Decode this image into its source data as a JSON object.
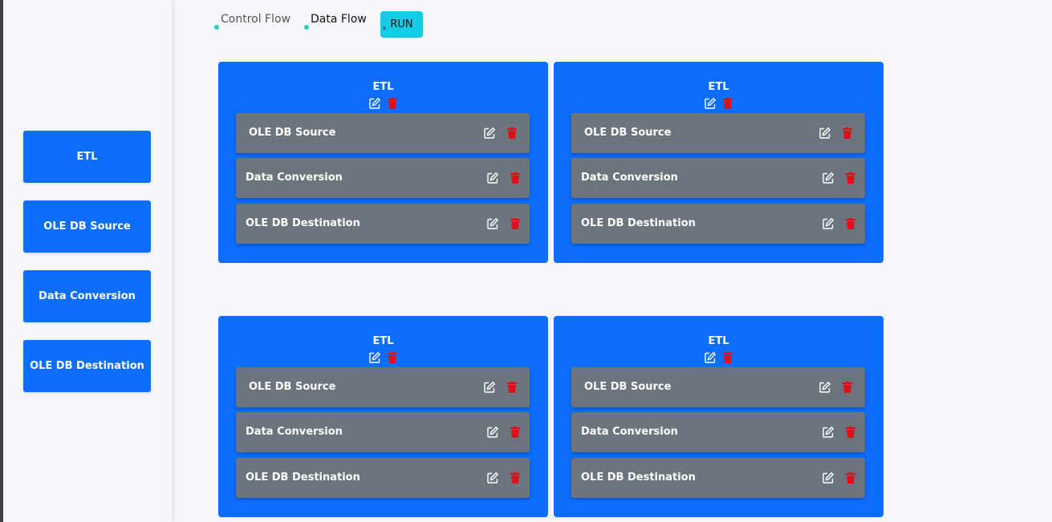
{
  "sidebar": {
    "items": [
      {
        "label": "ETL"
      },
      {
        "label": "OLE DB Source"
      },
      {
        "label": "Data Conversion"
      },
      {
        "label": "OLE DB Destination"
      }
    ]
  },
  "toolbar": {
    "tabs": [
      {
        "label": "Control Flow",
        "active": false
      },
      {
        "label": "Data Flow",
        "active": true
      }
    ],
    "run_label": "RUN"
  },
  "canvas": {
    "etl_tasks": [
      {
        "title": "ETL",
        "components": [
          {
            "label": "OLE DB Source"
          },
          {
            "label": "Data Conversion"
          },
          {
            "label": "OLE DB Destination"
          }
        ]
      },
      {
        "title": "ETL",
        "components": [
          {
            "label": "OLE DB Source"
          },
          {
            "label": "Data Conversion"
          },
          {
            "label": "OLE DB Destination"
          }
        ]
      },
      {
        "title": "ETL",
        "components": [
          {
            "label": "OLE DB Source"
          },
          {
            "label": "Data Conversion"
          },
          {
            "label": "OLE DB Destination"
          }
        ]
      },
      {
        "title": "ETL",
        "components": [
          {
            "label": "OLE DB Source"
          },
          {
            "label": "Data Conversion"
          },
          {
            "label": "OLE DB Destination"
          }
        ]
      }
    ]
  },
  "icons": {
    "edit": "edit-icon",
    "delete": "trash-icon"
  },
  "colors": {
    "primary": "#0d6efd",
    "component": "#6c757d",
    "run": "#13cde6",
    "delete": "#e0101a",
    "tab_dot": "#1ed2c8"
  }
}
